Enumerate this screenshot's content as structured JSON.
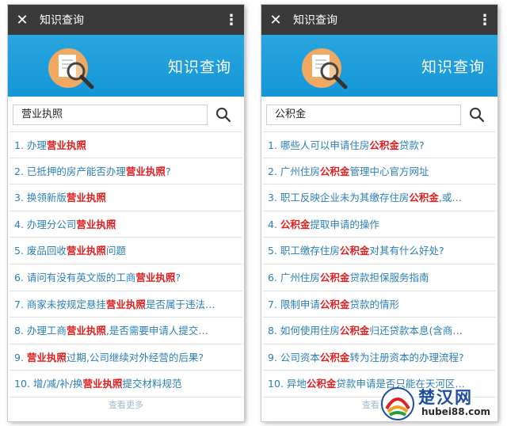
{
  "phones": [
    {
      "topbar": {
        "close_icon": "close-icon",
        "title": "知识查询",
        "more_icon": "more-vertical-icon"
      },
      "banner": {
        "title": "知识查询"
      },
      "search": {
        "value": "营业执照",
        "button_icon": "search-icon"
      },
      "results": [
        [
          {
            "t": "1. ",
            "h": false
          },
          {
            "t": "办理",
            "h": false
          },
          {
            "t": "营业执照",
            "h": true
          }
        ],
        [
          {
            "t": "2. ",
            "h": false
          },
          {
            "t": "已抵押的房产能否办理",
            "h": false
          },
          {
            "t": "营业执照",
            "h": true
          },
          {
            "t": "?",
            "h": false
          }
        ],
        [
          {
            "t": "3. ",
            "h": false
          },
          {
            "t": "换领新版",
            "h": false
          },
          {
            "t": "营业执照",
            "h": true
          }
        ],
        [
          {
            "t": "4. ",
            "h": false
          },
          {
            "t": "办理分公司",
            "h": false
          },
          {
            "t": "营业执照",
            "h": true
          }
        ],
        [
          {
            "t": "5. ",
            "h": false
          },
          {
            "t": "废品回收",
            "h": false
          },
          {
            "t": "营业执照",
            "h": true
          },
          {
            "t": "问题",
            "h": false
          }
        ],
        [
          {
            "t": "6. ",
            "h": false
          },
          {
            "t": "请问有没有英文版的工商",
            "h": false
          },
          {
            "t": "营业执照",
            "h": true
          },
          {
            "t": "?",
            "h": false
          }
        ],
        [
          {
            "t": "7. ",
            "h": false
          },
          {
            "t": "商家未按规定悬挂",
            "h": false
          },
          {
            "t": "营业执照",
            "h": true
          },
          {
            "t": "是否属于违法…",
            "h": false
          }
        ],
        [
          {
            "t": "8. ",
            "h": false
          },
          {
            "t": "办理工商",
            "h": false
          },
          {
            "t": "营业执照",
            "h": true
          },
          {
            "t": ",是否需要申请人提交…",
            "h": false
          }
        ],
        [
          {
            "t": "9. ",
            "h": false
          },
          {
            "t": "营业执照",
            "h": true
          },
          {
            "t": "过期,公司继续对外经营的后果?",
            "h": false
          }
        ],
        [
          {
            "t": "10. ",
            "h": false
          },
          {
            "t": "增/减/补/换",
            "h": false
          },
          {
            "t": "营业执照",
            "h": true
          },
          {
            "t": "提交材料规范",
            "h": false
          }
        ]
      ],
      "more_text": "查看更多"
    },
    {
      "topbar": {
        "close_icon": "close-icon",
        "title": "知识查询",
        "more_icon": "more-vertical-icon"
      },
      "banner": {
        "title": "知识查询"
      },
      "search": {
        "value": "公积金",
        "button_icon": "search-icon"
      },
      "results": [
        [
          {
            "t": "1. ",
            "h": false
          },
          {
            "t": "哪些人可以申请住房",
            "h": false
          },
          {
            "t": "公积金",
            "h": true
          },
          {
            "t": "贷款?",
            "h": false
          }
        ],
        [
          {
            "t": "2. ",
            "h": false
          },
          {
            "t": "广州住房",
            "h": false
          },
          {
            "t": "公积金",
            "h": true
          },
          {
            "t": "管理中心官方网址",
            "h": false
          }
        ],
        [
          {
            "t": "3. ",
            "h": false
          },
          {
            "t": "职工反映企业未为其缴存住房",
            "h": false
          },
          {
            "t": "公积金",
            "h": true
          },
          {
            "t": ",或…",
            "h": false
          }
        ],
        [
          {
            "t": "4. ",
            "h": false
          },
          {
            "t": "公积金",
            "h": true
          },
          {
            "t": "提取申请的操作",
            "h": false
          }
        ],
        [
          {
            "t": "5. ",
            "h": false
          },
          {
            "t": "职工缴存住房",
            "h": false
          },
          {
            "t": "公积金",
            "h": true
          },
          {
            "t": "对其有什么好处?",
            "h": false
          }
        ],
        [
          {
            "t": "6. ",
            "h": false
          },
          {
            "t": "广州住房",
            "h": false
          },
          {
            "t": "公积金",
            "h": true
          },
          {
            "t": "贷款担保服务指南",
            "h": false
          }
        ],
        [
          {
            "t": "7. ",
            "h": false
          },
          {
            "t": "限制申请",
            "h": false
          },
          {
            "t": "公积金",
            "h": true
          },
          {
            "t": "贷款的情形",
            "h": false
          }
        ],
        [
          {
            "t": "8. ",
            "h": false
          },
          {
            "t": "如何使用住房",
            "h": false
          },
          {
            "t": "公积金",
            "h": true
          },
          {
            "t": "归还贷款本息(含商…",
            "h": false
          }
        ],
        [
          {
            "t": "9. ",
            "h": false
          },
          {
            "t": "公司资本",
            "h": false
          },
          {
            "t": "公积金",
            "h": true
          },
          {
            "t": "转为注册资本的办理流程?",
            "h": false
          }
        ],
        [
          {
            "t": "10. ",
            "h": false
          },
          {
            "t": "异地",
            "h": false
          },
          {
            "t": "公积金",
            "h": true
          },
          {
            "t": "贷款申请是否只能在天河区…",
            "h": false
          }
        ]
      ],
      "more_text": "查看更多"
    }
  ],
  "watermark": {
    "title": "楚汉网",
    "url": "hubei88.com"
  },
  "colors": {
    "topbar": "#3a3a3a",
    "banner": "#1e9edb",
    "link": "#2a7fb7",
    "highlight": "#e02020"
  }
}
